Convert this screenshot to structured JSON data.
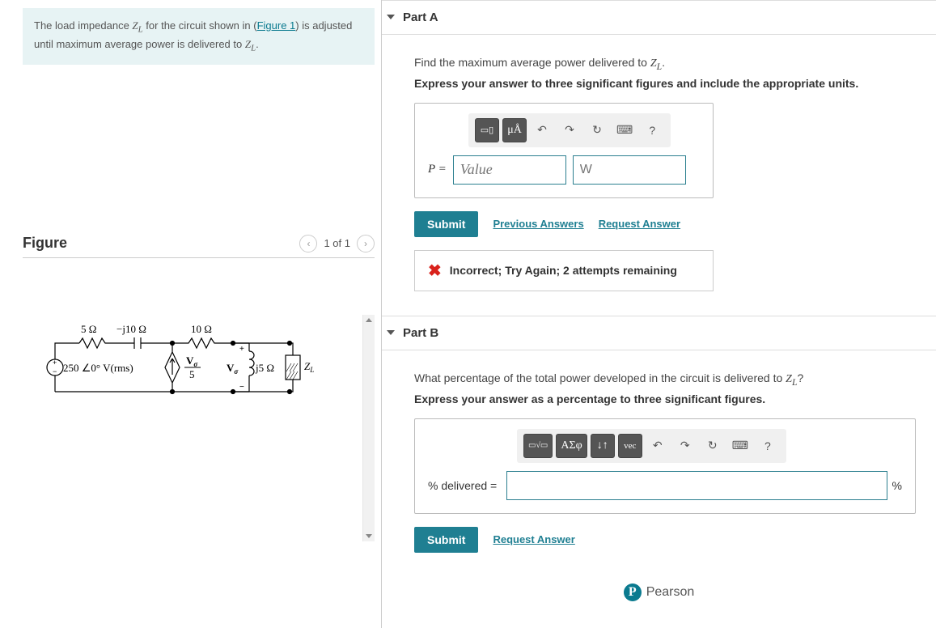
{
  "problem": {
    "text_before_link": "The load impedance ",
    "var1": "Z",
    "sub1": "L",
    "text_mid": " for the circuit shown in (",
    "link_text": "Figure 1",
    "text_after": ") is adjusted until maximum average power is delivered to ",
    "var2": "Z",
    "sub2": "L",
    "period": "."
  },
  "figure": {
    "heading": "Figure",
    "pager": "1 of 1",
    "labels": {
      "r1": "5 Ω",
      "c1": "−j10 Ω",
      "r2": "10 Ω",
      "src": "250 ∠0° V(rms)",
      "depsrc_top": "V",
      "depsrc_sub": "σ",
      "depsrc_den": "5",
      "vsigma": "V",
      "vsigma_sub": "σ",
      "l1": "j5 Ω",
      "zl": "Z",
      "zl_sub": "L"
    }
  },
  "partA": {
    "title": "Part A",
    "prompt_before": "Find the maximum average power delivered to ",
    "prompt_var": "Z",
    "prompt_sub": "L",
    "prompt_after": ".",
    "instruction": "Express your answer to three significant figures and include the appropriate units.",
    "toolbar": {
      "templates_icon": "▭▯",
      "units_label": "μÅ",
      "help": "?"
    },
    "lhs": "P",
    "equals": " = ",
    "value_placeholder": "Value",
    "unit_placeholder": "W",
    "submit": "Submit",
    "prev_answers": "Previous Answers",
    "request": "Request Answer",
    "feedback": "Incorrect; Try Again; 2 attempts remaining"
  },
  "partB": {
    "title": "Part B",
    "prompt_before": "What percentage of the total power developed in the circuit is delivered to ",
    "prompt_var": "Z",
    "prompt_sub": "L",
    "prompt_after": "?",
    "instruction": "Express your answer as a percentage to three significant figures.",
    "toolbar": {
      "templates_icon": "▭√▭",
      "symbols_label": "ΑΣφ",
      "arrows": "↓↑",
      "vec": "vec",
      "help": "?"
    },
    "lhs": "% delivered =",
    "unit": "%",
    "submit": "Submit",
    "request": "Request Answer"
  },
  "footer": {
    "brand": "Pearson",
    "logo_letter": "P"
  }
}
